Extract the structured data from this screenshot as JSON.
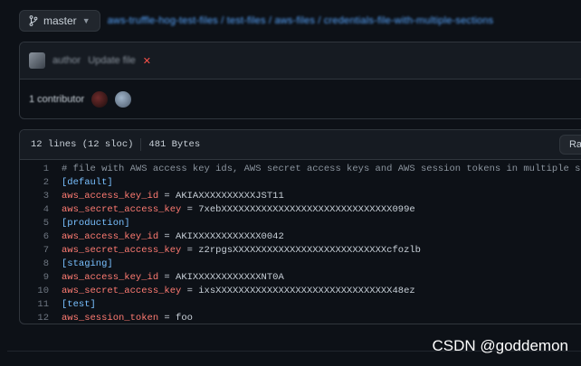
{
  "branch": {
    "label": "master",
    "icon": "git-branch-icon"
  },
  "breadcrumb": {
    "path": "aws-truffle-hog-test-files / test-files / aws-files / credentials-file-with-multiple-sections",
    "rest": ""
  },
  "commit": {
    "author": "author",
    "message": "Update file",
    "status_icon": "x-icon"
  },
  "contributors": {
    "label": "1 contributor"
  },
  "file": {
    "lines_info": "12 lines (12 sloc)",
    "size": "481 Bytes",
    "raw_label": "Raw",
    "lines": [
      {
        "n": "1",
        "type": "comment",
        "text": "# file with AWS access key ids, AWS secret access keys and AWS session tokens in multiple sections"
      },
      {
        "n": "2",
        "type": "section",
        "text": "[default]"
      },
      {
        "n": "3",
        "type": "kv",
        "key": "aws_access_key_id",
        "eq": " = ",
        "val": "AKIAXXXXXXXXXXJST11"
      },
      {
        "n": "4",
        "type": "kv",
        "key": "aws_secret_access_key",
        "eq": " = ",
        "val": "7xebXXXXXXXXXXXXXXXXXXXXXXXXXXXXXX099e"
      },
      {
        "n": "5",
        "type": "section",
        "text": "[production]"
      },
      {
        "n": "6",
        "type": "kv",
        "key": "aws_access_key_id",
        "eq": " = ",
        "val": "AKIXXXXXXXXXXXX0042"
      },
      {
        "n": "7",
        "type": "kv",
        "key": "aws_secret_access_key",
        "eq": " = ",
        "val": "z2rpgsXXXXXXXXXXXXXXXXXXXXXXXXXXXcfozlb"
      },
      {
        "n": "8",
        "type": "section",
        "text": "[staging]"
      },
      {
        "n": "9",
        "type": "kv",
        "key": "aws_access_key_id",
        "eq": " = ",
        "val": "AKIXXXXXXXXXXXXNT0A"
      },
      {
        "n": "10",
        "type": "kv",
        "key": "aws_secret_access_key",
        "eq": " = ",
        "val": "ixsXXXXXXXXXXXXXXXXXXXXXXXXXXXXXXX48ez"
      },
      {
        "n": "11",
        "type": "section",
        "text": "[test]"
      },
      {
        "n": "12",
        "type": "kv",
        "key": "aws_session_token",
        "eq": " = ",
        "val": "foo"
      }
    ]
  },
  "watermark": "CSDN @goddemon"
}
